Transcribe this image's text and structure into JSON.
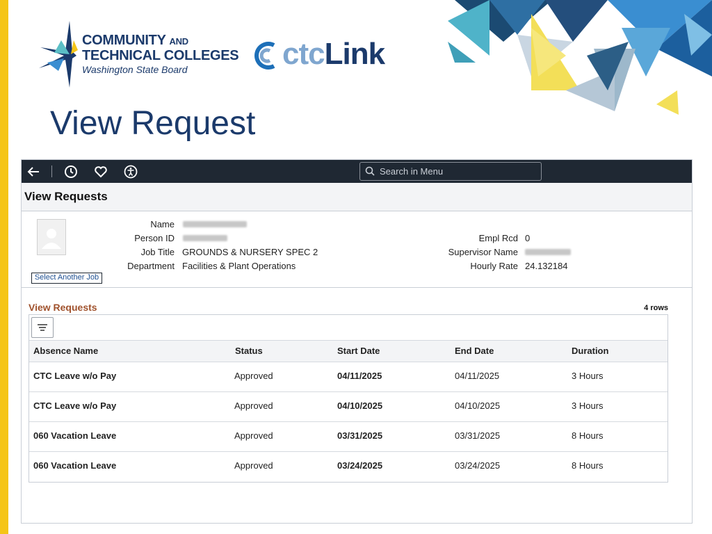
{
  "brand": {
    "sbctc_line1": "COMMUNITY",
    "sbctc_and": "AND",
    "sbctc_line2": "TECHNICAL COLLEGES",
    "sbctc_line3": "Washington State Board",
    "ctclink_ctc": "ctc",
    "ctclink_link": "Link"
  },
  "slide_title": "View Request",
  "navbar": {
    "icons": [
      "back-arrow-icon",
      "history-clock-icon",
      "favorites-heart-icon",
      "accessibility-icon"
    ],
    "search_placeholder": "Search in Menu"
  },
  "page_header": "View Requests",
  "employee": {
    "name_label": "Name",
    "person_id_label": "Person ID",
    "job_title_label": "Job Title",
    "job_title": "GROUNDS & NURSERY SPEC 2",
    "department_label": "Department",
    "department": "Facilities & Plant Operations",
    "empl_rcd_label": "Empl Rcd",
    "empl_rcd": "0",
    "supervisor_label": "Supervisor Name",
    "hourly_rate_label": "Hourly Rate",
    "hourly_rate": "24.132184",
    "select_job": "Select Another Job"
  },
  "grid": {
    "title": "View Requests",
    "row_count": "4 rows",
    "columns": [
      "Absence Name",
      "Status",
      "Start Date",
      "End Date",
      "Duration"
    ],
    "rows": [
      [
        "CTC Leave w/o Pay",
        "Approved",
        "04/11/2025",
        "04/11/2025",
        "3 Hours"
      ],
      [
        "CTC Leave w/o Pay",
        "Approved",
        "04/10/2025",
        "04/10/2025",
        "3 Hours"
      ],
      [
        "060 Vacation Leave",
        "Approved",
        "03/31/2025",
        "03/31/2025",
        "8 Hours"
      ],
      [
        "060 Vacation Leave",
        "Approved",
        "03/24/2025",
        "03/24/2025",
        "8 Hours"
      ]
    ]
  },
  "colors": {
    "accent_yellow": "#f5c518",
    "navy": "#1b3a6b",
    "navbar": "#1f2833",
    "grid_title": "#a0522d",
    "link": "#1d4f91"
  }
}
